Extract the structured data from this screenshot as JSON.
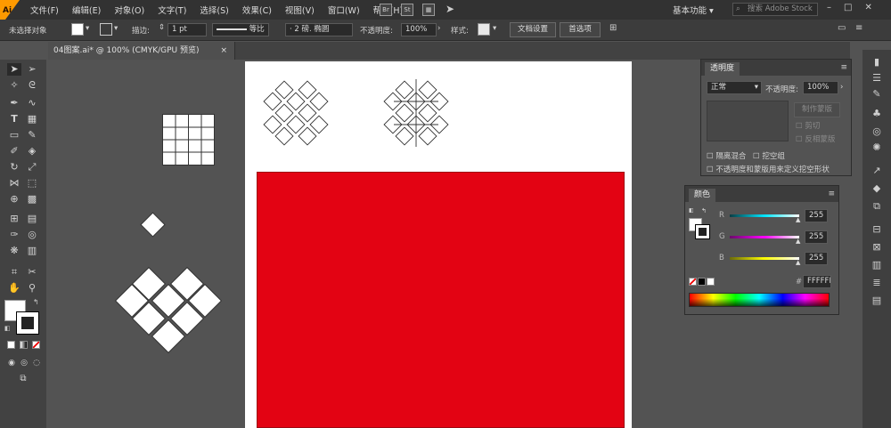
{
  "menubar": {
    "logo_text": "Ai",
    "menus": [
      "文件(F)",
      "编辑(E)",
      "对象(O)",
      "文字(T)",
      "选择(S)",
      "效果(C)",
      "视图(V)",
      "窗口(W)",
      "帮助(H)"
    ],
    "app_icons": [
      "Br",
      "St"
    ],
    "workspace": "基本功能",
    "search_placeholder": "搜索 Adobe Stock"
  },
  "control": {
    "selection_label": "未选择对象",
    "stroke_label": "描边:",
    "stroke_value": "1 pt",
    "stroke_profile": "等比",
    "brush_value": "2 磅. 椭圆",
    "opacity_label": "不透明度:",
    "opacity_value": "100%",
    "style_label": "样式:",
    "doc_setup": "文档设置",
    "preferences": "首选项"
  },
  "document": {
    "tab_title": "04图案.ai* @ 100% (CMYK/GPU 预览)",
    "close": "×"
  },
  "canvas": {
    "fill_color": "#ffffff",
    "rect_color": "#e30313"
  },
  "transparency_panel": {
    "title": "透明度",
    "blend_mode": "正常",
    "opacity_label": "不透明度:",
    "opacity_value": "100%",
    "make_mask": "制作蒙版",
    "clip": "剪切",
    "invert_mask": "反相蒙版",
    "isolate_blending": "隔离混合",
    "knockout_group": "挖空组",
    "opacity_mask_define": "不透明度和蒙版用来定义挖空形状"
  },
  "color_panel": {
    "title": "颜色",
    "channels": [
      {
        "label": "R",
        "value": "255",
        "color": "#00e5ff"
      },
      {
        "label": "G",
        "value": "255",
        "color": "#ff00ff"
      },
      {
        "label": "B",
        "value": "255",
        "color": "#ffff00"
      }
    ],
    "hex_label": "#",
    "hex_value": "FFFFFF"
  }
}
